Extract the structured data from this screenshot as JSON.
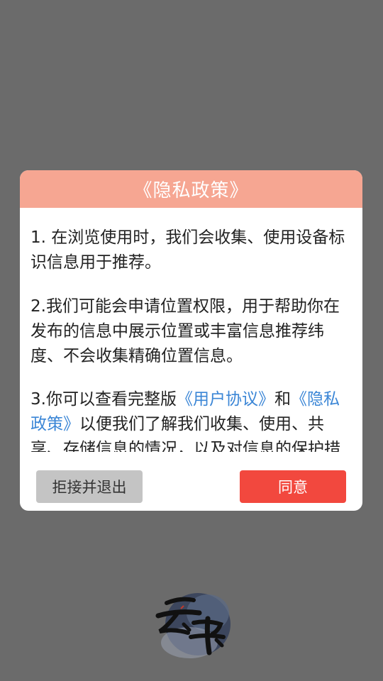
{
  "dialog": {
    "title": "《隐私政策》",
    "paragraphs": {
      "p1": "1. 在浏览使用时，我们会收集、使用设备标识信息用于推荐。",
      "p2": "2.我们可能会申请位置权限，用于帮助你在发布的信息中展示位置或丰富信息推荐纬度、不会收集精确位置信息。",
      "p3_before": "3.你可以查看完整版",
      "p3_link1": "《用户协议》",
      "p3_mid": "和",
      "p3_link2": "《隐私政策》",
      "p3_after": "以便我们了解我们收集、使用、共享、存储信息的情况，以及对信息的保护措施。"
    },
    "buttons": {
      "reject": "拒接并退出",
      "agree": "同意"
    }
  },
  "colors": {
    "overlay": "#6b6b6b",
    "header": "#f6a692",
    "link": "#3b86d6",
    "agree_button": "#f2483e",
    "reject_button": "#c4c4c4"
  },
  "logo": {
    "icon": "yunshu-calligraphy-logo",
    "text": "云书"
  }
}
